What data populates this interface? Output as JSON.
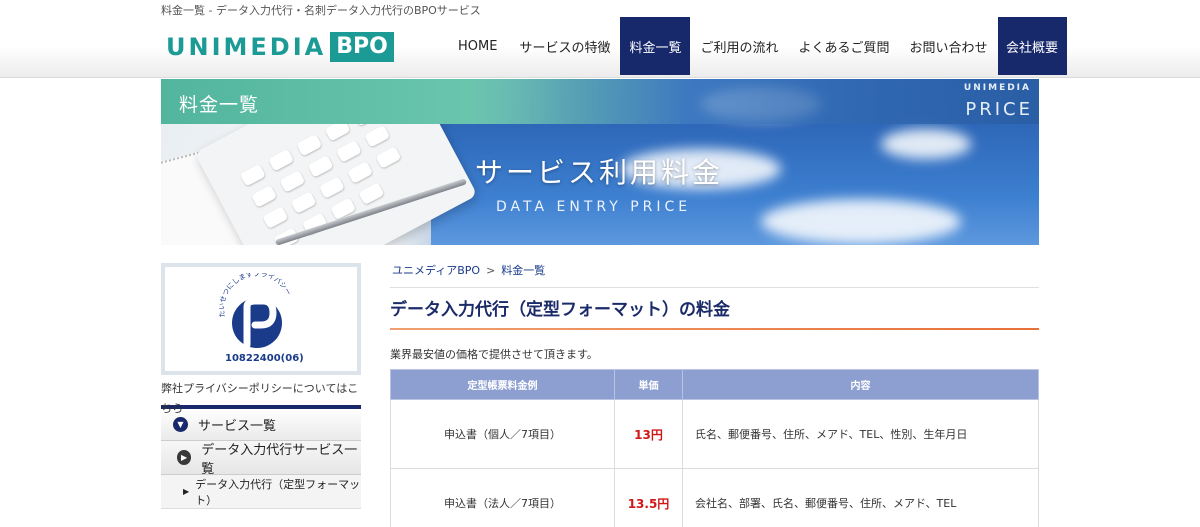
{
  "tagline": "料金一覧 - データ入力代行・名刺データ入力代行のBPOサービス",
  "logo": {
    "main": "UNIMEDIA",
    "badge": "BPO"
  },
  "nav": [
    {
      "label": "HOME",
      "state": "normal"
    },
    {
      "label": "サービスの特徴",
      "state": "normal"
    },
    {
      "label": "料金一覧",
      "state": "active"
    },
    {
      "label": "ご利用の流れ",
      "state": "normal"
    },
    {
      "label": "よくあるご質問",
      "state": "normal"
    },
    {
      "label": "お問い合わせ",
      "state": "normal"
    },
    {
      "label": "会社概要",
      "state": "dark"
    }
  ],
  "banner": {
    "corner_title": "料金一覧",
    "brand": "UNIMEDIA",
    "price_label": "PRICE",
    "title": "サービス利用料金",
    "subtitle": "DATA ENTRY PRICE"
  },
  "sidebar": {
    "privacy_mark_text": "たいせつにしますプライバシー",
    "privacy_number": "10822400(06)",
    "privacy_link": "弊社プライバシーポリシーについてはこちら",
    "menu_head": "サービス一覧",
    "menu_sub": "データ入力代行サービス一覧",
    "menu_item": "データ入力代行（定型フォーマット）"
  },
  "main": {
    "breadcrumb": [
      "ユニメディアBPO",
      "料金一覧"
    ],
    "breadcrumb_sep": ">",
    "heading": "データ入力代行（定型フォーマット）の料金",
    "intro": "業界最安値の価格で提供させて頂きます。",
    "table": {
      "headers": [
        "定型帳票料金例",
        "単価",
        "内容"
      ],
      "rows": [
        {
          "example": "申込書（個人／7項目）",
          "price": "13円",
          "content": "氏名、郵便番号、住所、メアド、TEL、性別、生年月日"
        },
        {
          "example": "申込書（法人／7項目）",
          "price": "13.5円",
          "content": "会社名、部署、氏名、郵便番号、住所、メアド、TEL"
        }
      ]
    }
  },
  "colors": {
    "navy": "#18296b",
    "teal": "#1c9a95",
    "price_red": "#d01818",
    "table_header": "#8d9fd0"
  }
}
